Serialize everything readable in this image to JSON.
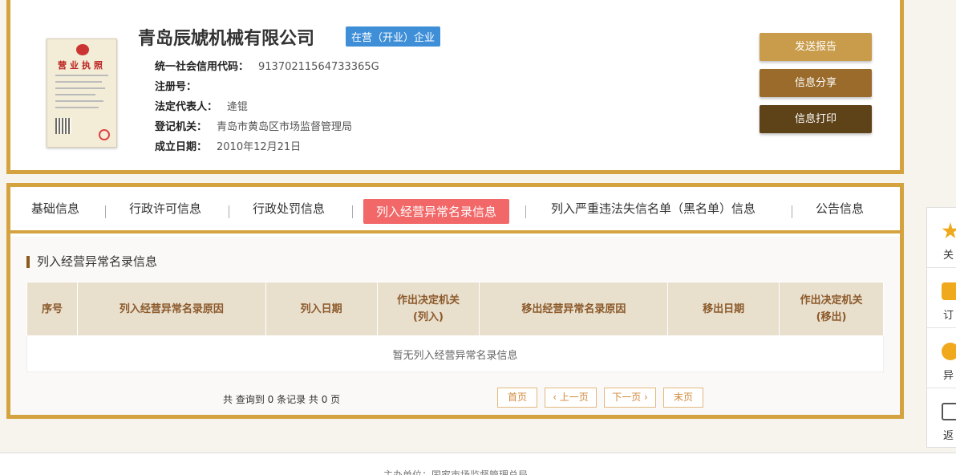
{
  "company": {
    "name": "青岛辰虓机械有限公司",
    "status": "在营（开业）企业",
    "license_title": "营业执照",
    "fields": [
      {
        "label": "统一社会信用代码：",
        "value": "91370211564733365G"
      },
      {
        "label": "注册号：",
        "value": ""
      },
      {
        "label": "法定代表人：",
        "value": "逄锟"
      },
      {
        "label": "登记机关：",
        "value": "青岛市黄岛区市场监督管理局"
      },
      {
        "label": "成立日期：",
        "value": "2010年12月21日"
      }
    ]
  },
  "actions": {
    "send_report": "发送报告",
    "share_info": "信息分享",
    "print_info": "信息打印"
  },
  "tabs": [
    "基础信息",
    "行政许可信息",
    "行政处罚信息",
    "列入经营异常名录信息",
    "列入严重违法失信名单（黑名单）信息",
    "公告信息"
  ],
  "section": {
    "title": "列入经营异常名录信息",
    "columns": [
      "序号",
      "列入经营异常名录原因",
      "列入日期",
      "作出决定机关\n(列入)",
      "移出经营异常名录原因",
      "移出日期",
      "作出决定机关\n(移出)"
    ],
    "empty_message": "暂无列入经营异常名录信息"
  },
  "pager": {
    "summary": "共 查询到 0 条记录 共 0 页",
    "first": "首页",
    "prev": "‹ 上一页",
    "next": "下一页 ›",
    "last": "末页"
  },
  "sidebar": [
    "关",
    "订",
    "异",
    "返"
  ],
  "footer": {
    "text": "主办单位：国家市场监督管理总局"
  },
  "colors": {
    "accent_gold": "#d4a33f",
    "active_tab": "#f26767",
    "status_blue": "#3f8fd8"
  }
}
